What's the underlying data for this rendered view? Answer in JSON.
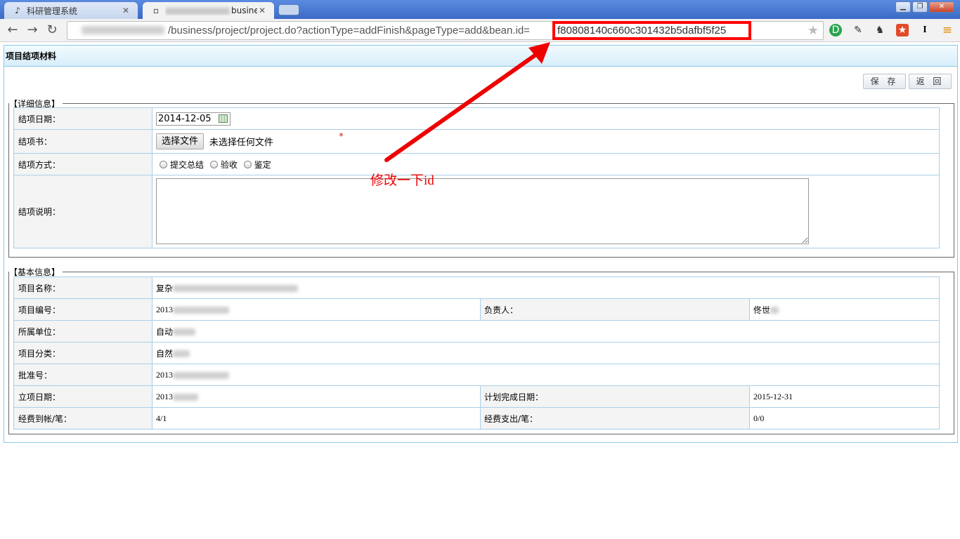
{
  "browser": {
    "tabs": [
      {
        "title": "科研管理系统",
        "icon": "app-logo-icon"
      },
      {
        "title": "business",
        "icon": "page-icon"
      }
    ],
    "window_buttons": [
      "minimize",
      "restore",
      "close"
    ],
    "url_path": "/business/project/project.do?actionType=addFinish&pageType=add&bean.id=",
    "url_id": "f80808140c660c301432b5dafbf5f25"
  },
  "page": {
    "title": "项目结项材料",
    "save_label": "保 存",
    "back_label": "返 回",
    "detail": {
      "legend": "【详细信息】",
      "finish_date_label": "结项日期：",
      "finish_date_value": "2014-12-05",
      "book_label": "结项书：",
      "choose_file_label": "选择文件",
      "file_status": "未选择任何文件",
      "required_mark": "*",
      "method_label": "结项方式：",
      "method_options": [
        "提交总结",
        "验收",
        "鉴定"
      ],
      "desc_label": "结项说明："
    },
    "basic": {
      "legend": "【基本信息】",
      "name_label": "项目名称：",
      "name_value": "复杂",
      "number_label": "项目编号：",
      "number_value": "2013",
      "owner_label": "负责人：",
      "owner_value": "佟世",
      "unit_label": "所属单位：",
      "unit_value": "自动",
      "category_label": "项目分类：",
      "category_value": "自然",
      "approval_label": "批准号：",
      "approval_value": "2013",
      "start_label": "立项日期：",
      "start_value": "2013",
      "plan_label": "计划完成日期：",
      "plan_value": "2015-12-31",
      "funds_in_label": "经费到帐/笔：",
      "funds_in_value": "4/1",
      "funds_out_label": "经费支出/笔：",
      "funds_out_value": "0/0"
    }
  },
  "annotation": {
    "text": "修改一下id",
    "color": "#ee0000"
  }
}
